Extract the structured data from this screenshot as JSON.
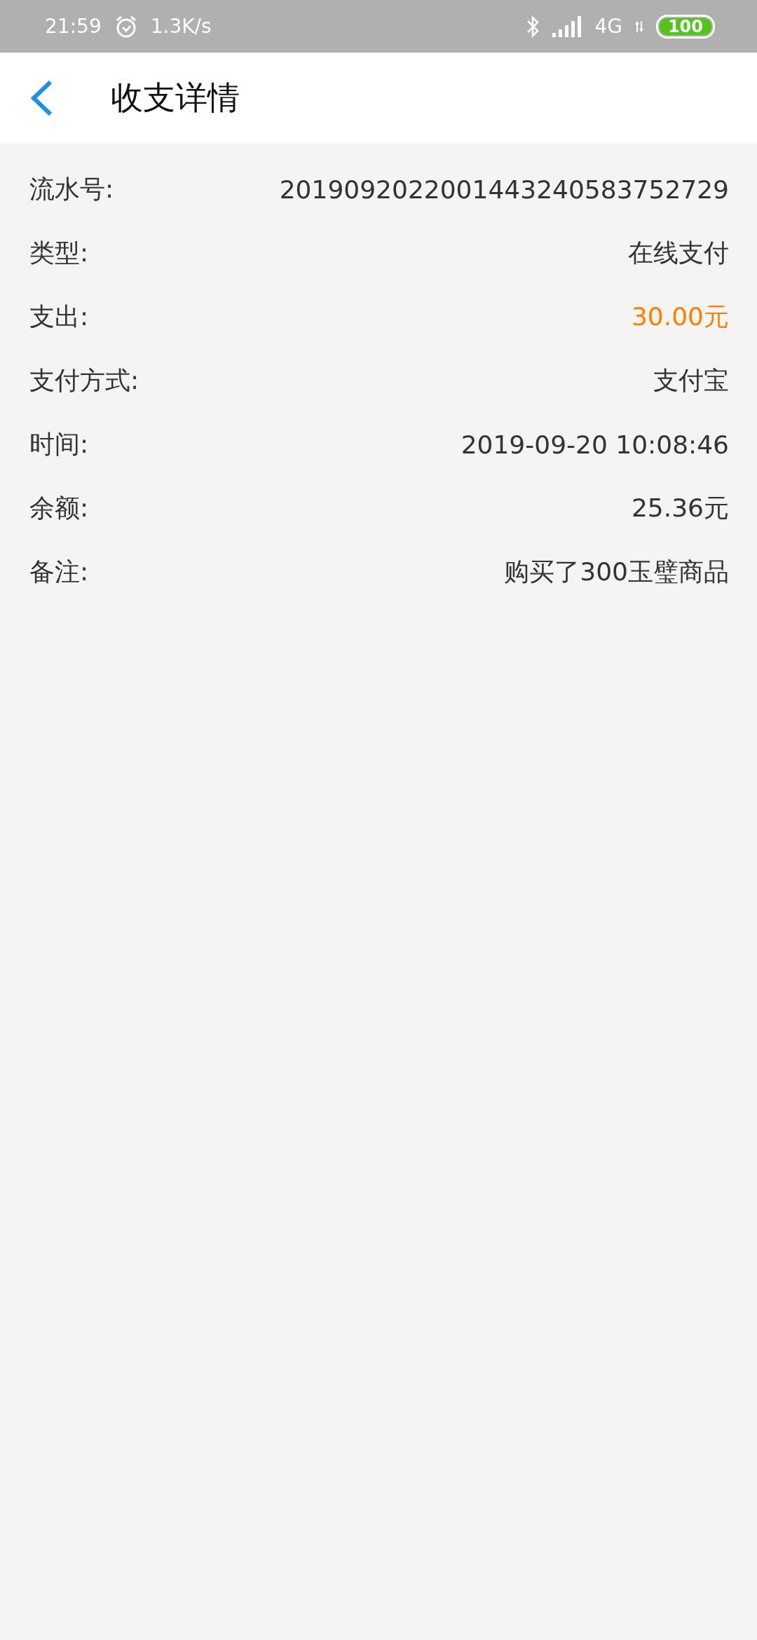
{
  "status_bar": {
    "time": "21:59",
    "speed": "1.3K/s",
    "network": "4G",
    "battery": "100"
  },
  "header": {
    "title": "收支详情"
  },
  "rows": [
    {
      "label": "流水号:",
      "value": "2019092022001443240583752729",
      "highlight": false
    },
    {
      "label": "类型:",
      "value": "在线支付",
      "highlight": false
    },
    {
      "label": "支出:",
      "value": "30.00元",
      "highlight": true
    },
    {
      "label": "支付方式:",
      "value": "支付宝",
      "highlight": false
    },
    {
      "label": "时间:",
      "value": "2019-09-20  10:08:46",
      "highlight": false
    },
    {
      "label": "余额:",
      "value": "25.36元",
      "highlight": false
    },
    {
      "label": "备注:",
      "value": "购买了300玉璧商品",
      "highlight": false
    }
  ]
}
